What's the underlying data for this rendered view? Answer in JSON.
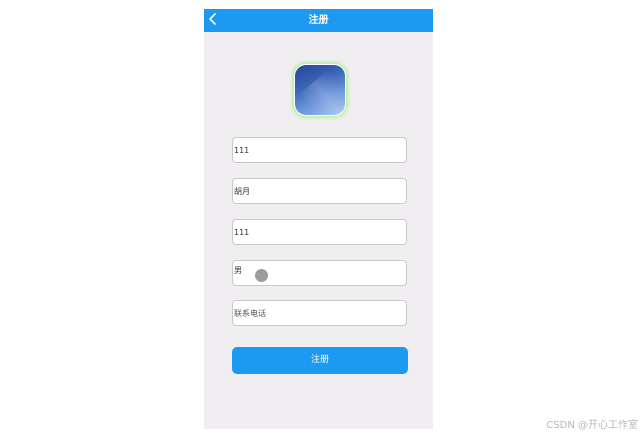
{
  "header": {
    "title": "注册",
    "back_icon": "chevron-left-icon"
  },
  "avatar": {
    "description_icon": "avatar-image",
    "glow_color": "#b7ef9b"
  },
  "form": {
    "fields": [
      {
        "value": "111",
        "placeholder": ""
      },
      {
        "value": "胡月",
        "placeholder": ""
      },
      {
        "value": "111",
        "placeholder": ""
      },
      {
        "value": "男",
        "placeholder": ""
      },
      {
        "value": "",
        "placeholder": "联系电话"
      }
    ],
    "submit_label": "注册"
  },
  "colors": {
    "primary": "#1c9af2",
    "background": "#f0eef0"
  },
  "watermark": "CSDN @开心工作室"
}
